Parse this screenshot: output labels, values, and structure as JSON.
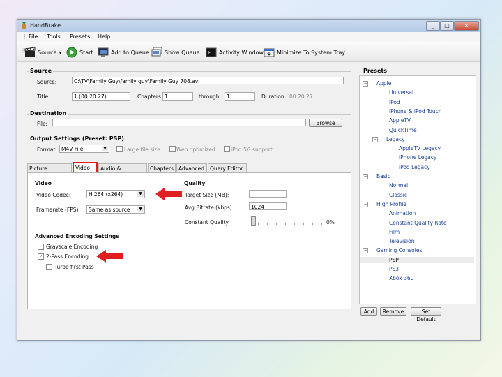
{
  "window": {
    "title": "HandBrake",
    "controls": [
      "_",
      "□",
      "×"
    ]
  },
  "menu": [
    "File",
    "Tools",
    "Presets",
    "Help"
  ],
  "toolbar": [
    {
      "label": "Source",
      "icon": "clapperboard-icon",
      "dropdown": "▾"
    },
    {
      "label": "Start",
      "icon": "play-icon"
    },
    {
      "label": "Add to Queue",
      "icon": "add-queue-icon"
    },
    {
      "label": "Show Queue",
      "icon": "queue-icon"
    },
    {
      "label": "Activity Window",
      "icon": "terminal-icon"
    },
    {
      "label": "Minimize To System Tray",
      "icon": "tray-icon"
    }
  ],
  "source": {
    "group": "Source",
    "source_label": "Source:",
    "source_value": "C:\\TV\\Family Guy\\family guy\\Family Guy 708.avi",
    "title_label": "Title:",
    "title_value": "1 (00:20:27)",
    "chapters_label": "Chapters:",
    "chapter_start": "1",
    "through_label": "through",
    "chapter_end": "1",
    "duration_label": "Duration:",
    "duration_value": "00:20:27"
  },
  "destination": {
    "group": "Destination",
    "file_label": "File:",
    "file_value": "",
    "browse_label": "Browse"
  },
  "output": {
    "group": "Output Settings (Preset: PSP)",
    "format_label": "Format:",
    "format_value": "M4V File",
    "large_file": "Large file size",
    "web_optimized": "Web optimized",
    "ipod_5g": "iPod 5G support"
  },
  "tabs": [
    "Picture Settings",
    "Video",
    "Audio & Subtitles",
    "Chapters",
    "Advanced",
    "Query Editor"
  ],
  "active_tab": "Video",
  "video": {
    "section": "Video",
    "codec_label": "Video Codec:",
    "codec_value": "H.264 (x264)",
    "framerate_label": "Framerate (FPS):",
    "framerate_value": "Same as source",
    "quality_section": "Quality",
    "target_size_label": "Target Size (MB):",
    "target_size_value": "",
    "avg_bitrate_label": "Avg Bitrate (kbps):",
    "avg_bitrate_value": "1024",
    "constant_quality_label": "Constant Quality:",
    "constant_quality_value": "0%",
    "constant_quality_level": 0,
    "advanced_section": "Advanced Encoding Settings",
    "grayscale_label": "Grayscale Encoding",
    "grayscale_checked": false,
    "twopass_label": "2-Pass Encoding",
    "twopass_checked": true,
    "turbo_label": "Turbo first Pass",
    "turbo_checked": false
  },
  "presets": {
    "title": "Presets",
    "items": [
      {
        "label": "Apple",
        "level": 0,
        "expander": "⊟"
      },
      {
        "label": "Universal",
        "level": 1
      },
      {
        "label": "iPod",
        "level": 1
      },
      {
        "label": "iPhone & iPod Touch",
        "level": 1
      },
      {
        "label": "AppleTV",
        "level": 1
      },
      {
        "label": "QuickTime",
        "level": 1
      },
      {
        "label": "Legacy",
        "level": 1,
        "expander": "⊟"
      },
      {
        "label": "AppleTV Legacy",
        "level": 2
      },
      {
        "label": "iPhone Legacy",
        "level": 2
      },
      {
        "label": "iPod Legacy",
        "level": 2
      },
      {
        "label": "Basic",
        "level": 0,
        "expander": "⊟"
      },
      {
        "label": "Normal",
        "level": 1
      },
      {
        "label": "Classic",
        "level": 1
      },
      {
        "label": "High Profile",
        "level": 0,
        "expander": "⊟"
      },
      {
        "label": "Animation",
        "level": 1
      },
      {
        "label": "Constant Quality Rate",
        "level": 1
      },
      {
        "label": "Film",
        "level": 1
      },
      {
        "label": "Television",
        "level": 1
      },
      {
        "label": "Gaming Consoles",
        "level": 0,
        "expander": "⊟"
      },
      {
        "label": "PSP",
        "level": 1,
        "selected": true
      },
      {
        "label": "PS3",
        "level": 1
      },
      {
        "label": "Xbox 360",
        "level": 1
      }
    ],
    "add_label": "Add",
    "remove_label": "Remove",
    "set_default_label": "Set Default"
  },
  "colors": {
    "accent_blue": "#1a3f9a",
    "annotation_red": "#e02020"
  }
}
